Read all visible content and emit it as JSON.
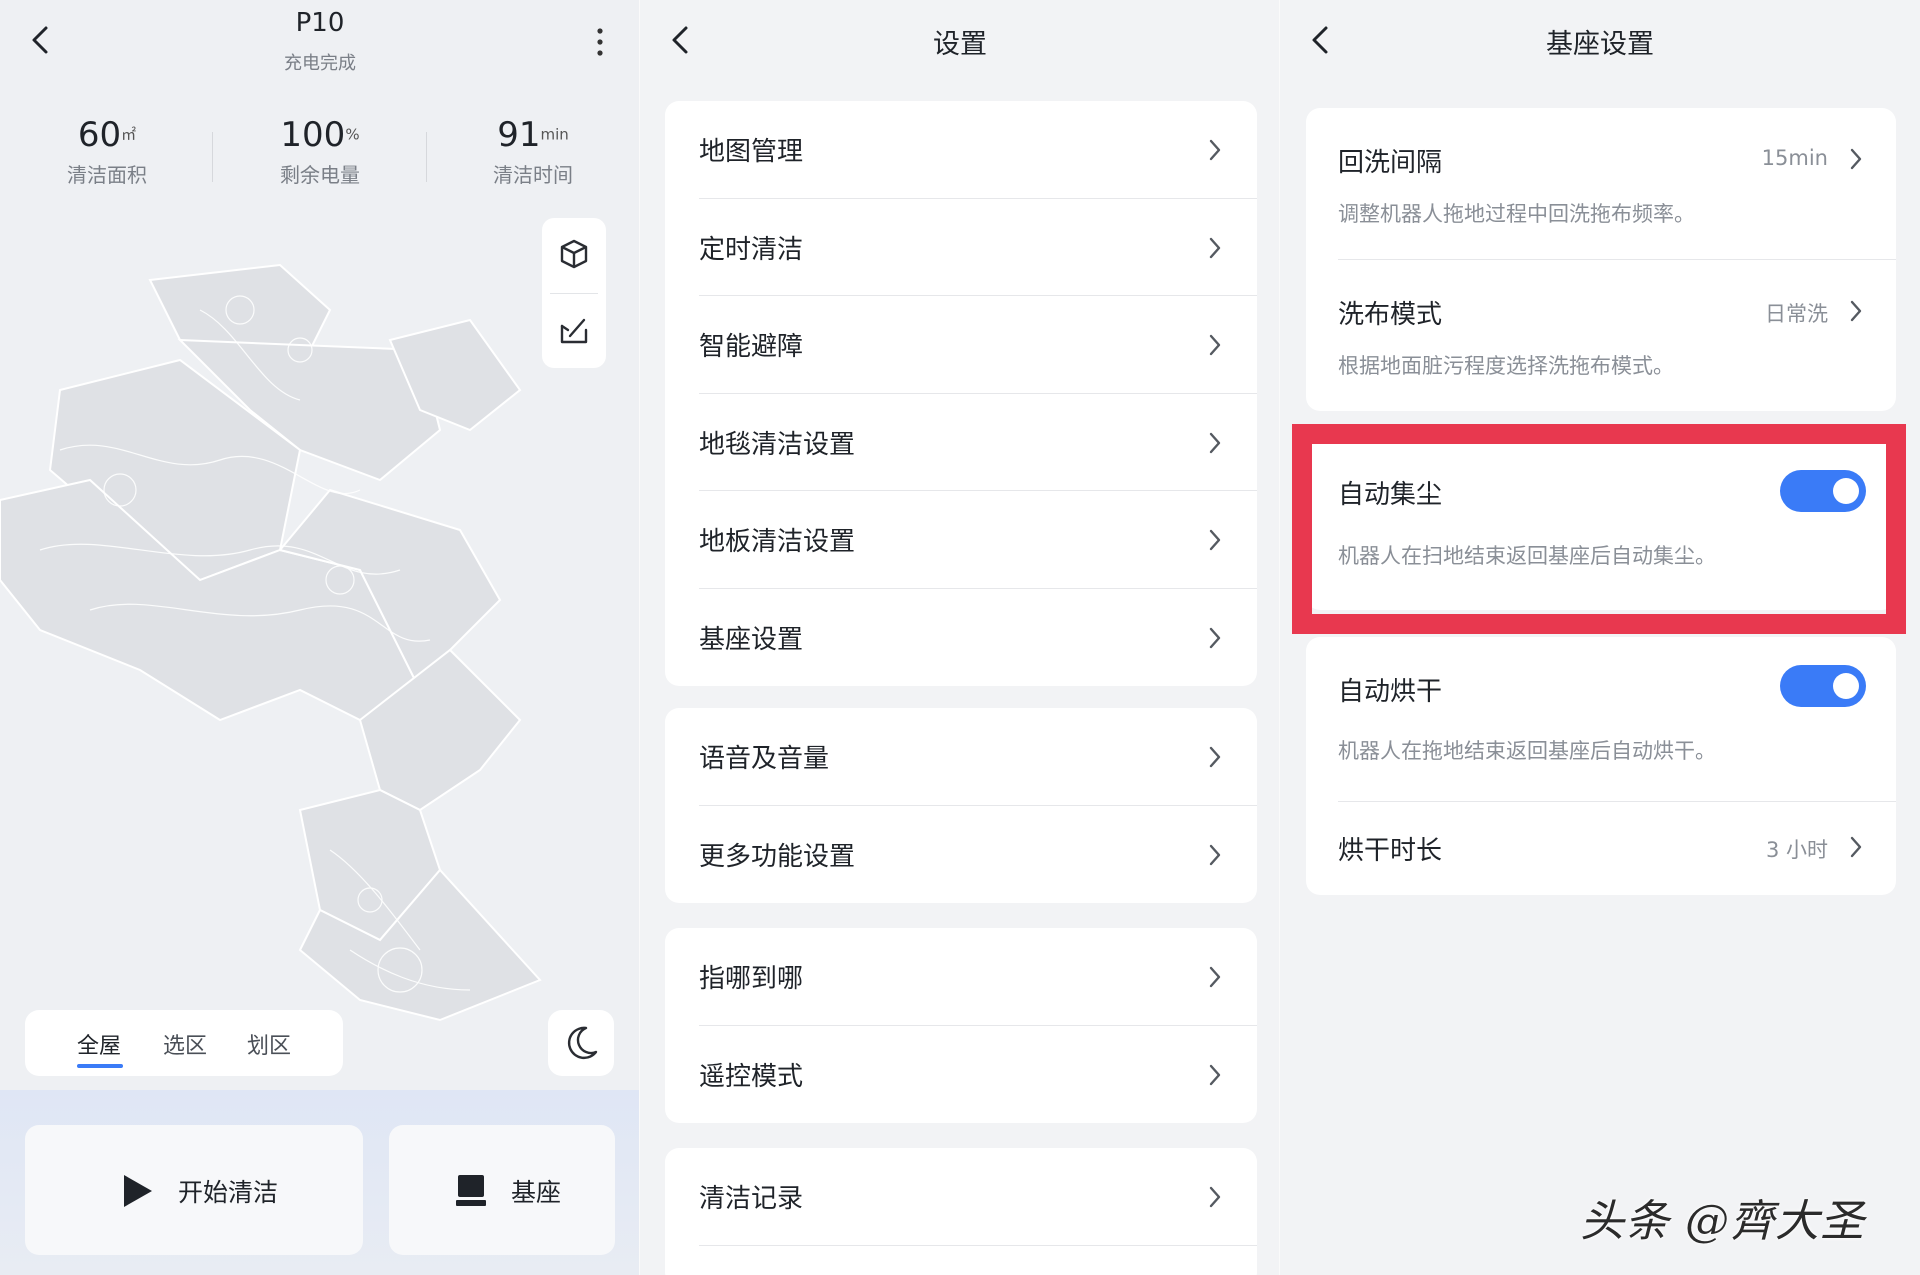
{
  "home": {
    "title": "P10",
    "status": "充电完成",
    "stats": [
      {
        "value": "60",
        "unit": "㎡",
        "label": "清洁面积"
      },
      {
        "value": "100",
        "unit": "%",
        "label": "剩余电量"
      },
      {
        "value": "91",
        "unit": "min",
        "label": "清洁时间"
      }
    ],
    "mode_tabs": [
      "全屋",
      "选区",
      "划区"
    ],
    "actions": {
      "start": "开始清洁",
      "dock": "基座"
    }
  },
  "settings": {
    "title": "设置",
    "groups": [
      [
        "地图管理",
        "定时清洁",
        "智能避障",
        "地毯清洁设置",
        "地板清洁设置",
        "基座设置"
      ],
      [
        "语音及音量",
        "更多功能设置"
      ],
      [
        "指哪到哪",
        "遥控模式"
      ],
      [
        "清洁记录"
      ]
    ]
  },
  "dock": {
    "title": "基座设置",
    "wash_interval": {
      "label": "回洗间隔",
      "value": "15min",
      "desc": "调整机器人拖地过程中回洗拖布频率。"
    },
    "wash_mode": {
      "label": "洗布模式",
      "value": "日常洗",
      "desc": "根据地面脏污程度选择洗拖布模式。"
    },
    "auto_empty": {
      "label": "自动集尘",
      "on": true,
      "desc": "机器人在扫地结束返回基座后自动集尘。"
    },
    "auto_dry": {
      "label": "自动烘干",
      "on": true,
      "desc": "机器人在拖地结束返回基座后自动烘干。"
    },
    "dry_duration": {
      "label": "烘干时长",
      "value": "3 小时"
    }
  },
  "watermark": "头条 @齊大圣",
  "colors": {
    "accent": "#3a7bf7",
    "highlight": "#e8384f"
  }
}
